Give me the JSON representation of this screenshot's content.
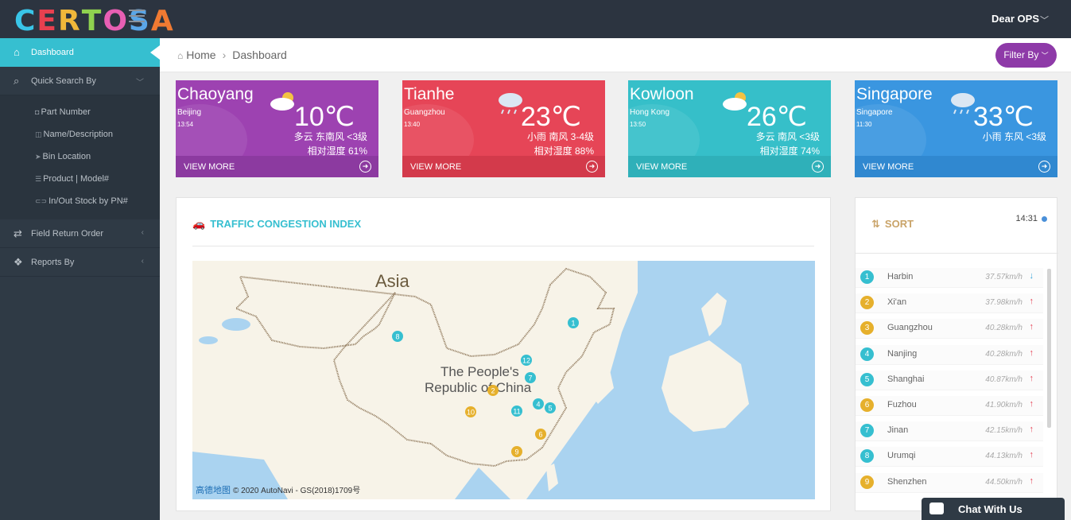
{
  "app": {
    "logo": "CERTOSA",
    "user": "Dear OPS",
    "logo_colors": [
      "#39c5e8",
      "#e8404f",
      "#f0b73a",
      "#8fd14f",
      "#e85fb3",
      "#5aa6e8",
      "#f07a32"
    ]
  },
  "sidebar": {
    "active": {
      "label": "Dashboard",
      "icon": "home-icon"
    },
    "quick_search": {
      "label": "Quick Search By",
      "icon": "search-icon"
    },
    "sub_items": [
      {
        "label": "Part Number",
        "icon": "box-icon"
      },
      {
        "label": "Name/Description",
        "icon": "tag-icon"
      },
      {
        "label": "Bin Location",
        "icon": "location-arrow-icon"
      },
      {
        "label": "Product | Model#",
        "icon": "list-icon"
      },
      {
        "label": "In/Out Stock by PN#",
        "icon": "toggle-icon"
      }
    ],
    "field_return": {
      "label": "Field Return Order",
      "icon": "exchange-icon"
    },
    "reports": {
      "label": "Reports By",
      "icon": "cubes-icon"
    }
  },
  "header": {
    "crumb_home": "Home",
    "crumb_current": "Dashboard",
    "filter_label": "Filter By"
  },
  "weather": [
    {
      "city": "Chaoyang",
      "region": "Beijing",
      "time": "13:54",
      "temp": "10℃",
      "wind": "多云 东南风 <3级",
      "humidity": "相对湿度 61%",
      "more": "VIEW MORE",
      "color": "#9d42b1",
      "bar": "#8c3aa0",
      "icon": "partly-cloudy-icon"
    },
    {
      "city": "Tianhe",
      "region": "Guangzhou",
      "time": "13:40",
      "temp": "23℃",
      "wind": "小雨 南风 3-4级",
      "humidity": "相对湿度 88%",
      "more": "VIEW MORE",
      "color": "#e64557",
      "bar": "#d33a4b",
      "icon": "rain-cloud-icon"
    },
    {
      "city": "Kowloon",
      "region": "Hong Kong",
      "time": "13:50",
      "temp": "26℃",
      "wind": "多云 南风 <3级",
      "humidity": "相对湿度 74%",
      "more": "VIEW MORE",
      "color": "#36bfc9",
      "bar": "#2fb0b9",
      "icon": "partly-cloudy-icon"
    },
    {
      "city": "Singapore",
      "region": "Singapore",
      "time": "11:30",
      "temp": "33℃",
      "wind": "小雨 东风 <3级",
      "humidity": "",
      "more": "VIEW MORE",
      "color": "#3a96e0",
      "bar": "#3088d0",
      "icon": "rain-cloud-icon"
    }
  ],
  "traffic": {
    "title": "TRAFFIC CONGESTION INDEX",
    "map_label_continent": "Asia",
    "map_label_country_1": "The People's",
    "map_label_country_2": "Republic of China",
    "credit_logo": "高德地图",
    "credit": "© 2020 AutoNavi - GS(2018)1709号",
    "markers": [
      {
        "n": "1",
        "color": "#36bfd0"
      },
      {
        "n": "2",
        "color": "#e6b02c"
      },
      {
        "n": "4",
        "color": "#36bfd0"
      },
      {
        "n": "5",
        "color": "#36bfd0"
      },
      {
        "n": "6",
        "color": "#e6b02c"
      },
      {
        "n": "7",
        "color": "#36bfd0"
      },
      {
        "n": "8",
        "color": "#36bfd0"
      },
      {
        "n": "9",
        "color": "#e6b02c"
      },
      {
        "n": "10",
        "color": "#e6b02c"
      },
      {
        "n": "11",
        "color": "#36bfd0"
      },
      {
        "n": "12",
        "color": "#36bfd0"
      }
    ]
  },
  "sort": {
    "title": "SORT",
    "time": "14:31",
    "rows": [
      {
        "rank": "1",
        "city": "Harbin",
        "speed": "37.57km/h",
        "trend": "↓",
        "trend_color": "#36a3d9",
        "badge": "#36bfd0"
      },
      {
        "rank": "2",
        "city": "Xi'an",
        "speed": "37.98km/h",
        "trend": "↑",
        "trend_color": "#e64557",
        "badge": "#e6b02c"
      },
      {
        "rank": "3",
        "city": "Guangzhou",
        "speed": "40.28km/h",
        "trend": "↑",
        "trend_color": "#e64557",
        "badge": "#e6b02c"
      },
      {
        "rank": "4",
        "city": "Nanjing",
        "speed": "40.28km/h",
        "trend": "↑",
        "trend_color": "#e64557",
        "badge": "#36bfd0"
      },
      {
        "rank": "5",
        "city": "Shanghai",
        "speed": "40.87km/h",
        "trend": "↑",
        "trend_color": "#e64557",
        "badge": "#36bfd0"
      },
      {
        "rank": "6",
        "city": "Fuzhou",
        "speed": "41.90km/h",
        "trend": "↑",
        "trend_color": "#e64557",
        "badge": "#e6b02c"
      },
      {
        "rank": "7",
        "city": "Jinan",
        "speed": "42.15km/h",
        "trend": "↑",
        "trend_color": "#e64557",
        "badge": "#36bfd0"
      },
      {
        "rank": "8",
        "city": "Urumqi",
        "speed": "44.13km/h",
        "trend": "↑",
        "trend_color": "#e64557",
        "badge": "#36bfd0"
      },
      {
        "rank": "9",
        "city": "Shenzhen",
        "speed": "44.50km/h",
        "trend": "↑",
        "trend_color": "#e64557",
        "badge": "#e6b02c"
      }
    ]
  },
  "chat": {
    "label": "Chat With Us"
  }
}
